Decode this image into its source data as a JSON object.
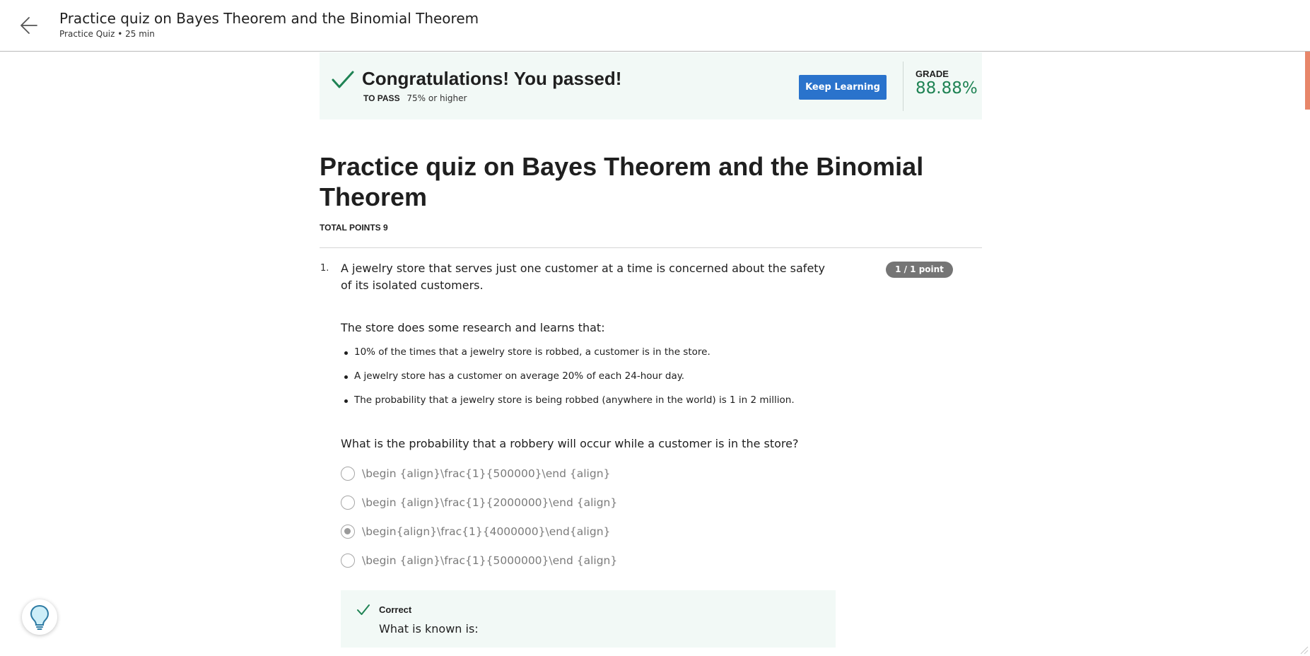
{
  "header": {
    "title": "Practice quiz on Bayes Theorem and the Binomial Theorem",
    "subtitle": "Practice Quiz • 25 min"
  },
  "result_banner": {
    "heading": "Congratulations! You passed!",
    "to_pass_label": "TO PASS",
    "to_pass_value": "75% or higher",
    "keep_learning_label": "Keep Learning",
    "grade_label": "GRADE",
    "grade_value": "88.88%"
  },
  "quiz": {
    "title": "Practice quiz on Bayes Theorem and the Binomial Theorem",
    "total_points": "TOTAL POINTS 9"
  },
  "question": {
    "number": "1.",
    "text": "A jewelry store that serves just one customer at a time is concerned about the safety of its isolated customers.",
    "points_badge": "1 / 1 point",
    "research_intro": "The store does some research and learns that:",
    "facts": [
      "10% of the times that a jewelry store is robbed, a customer is in the store.",
      "A jewelry store has a customer on average 20% of each 24-hour day.",
      "The probability that a jewelry store is being robbed (anywhere in the world) is 1 in 2 million."
    ],
    "prompt": "What is the probability that a robbery will occur while a customer is in the store?",
    "options": [
      {
        "label": "\\begin {align}\\frac{1}{500000}\\end {align}",
        "selected": false
      },
      {
        "label": "\\begin {align}\\frac{1}{2000000}\\end {align}",
        "selected": false
      },
      {
        "label": "\\begin{align}\\frac{1}{4000000}\\end{align}",
        "selected": true
      },
      {
        "label": "\\begin {align}\\frac{1}{5000000}\\end {align}",
        "selected": false
      }
    ],
    "feedback": {
      "status": "Correct",
      "text": "What is known is:"
    }
  },
  "colors": {
    "accent": "#2a73cc",
    "success": "#1f8354",
    "banner_bg": "#f2f9f6",
    "badge_bg": "#757575"
  },
  "icons": {
    "back": "arrow-left-icon",
    "passed": "check-icon",
    "feedback": "check-icon",
    "help": "lightbulb-icon"
  }
}
